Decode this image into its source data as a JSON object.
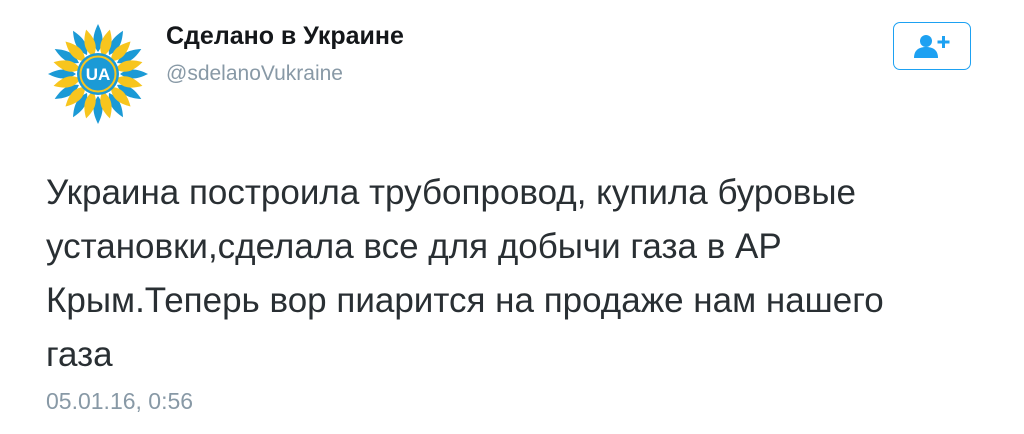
{
  "tweet": {
    "avatar_text": "UA",
    "display_name": "Сделано в Украине",
    "handle": "@sdelanoVukraine",
    "follow_icon": "add-user-icon",
    "text": "Украина построила трубопровод, купила буровые\nустановки,сделала все для добычи газа в АР\nКрым.Теперь вор пиарится на продаже нам нашего\nгаза",
    "timestamp": "05.01.16, 0:56"
  },
  "colors": {
    "accent": "#1da1f2",
    "text": "#292f33",
    "secondary_text": "#8899a6",
    "avatar_yellow": "#f7c51e",
    "avatar_blue": "#1b9ad6"
  }
}
